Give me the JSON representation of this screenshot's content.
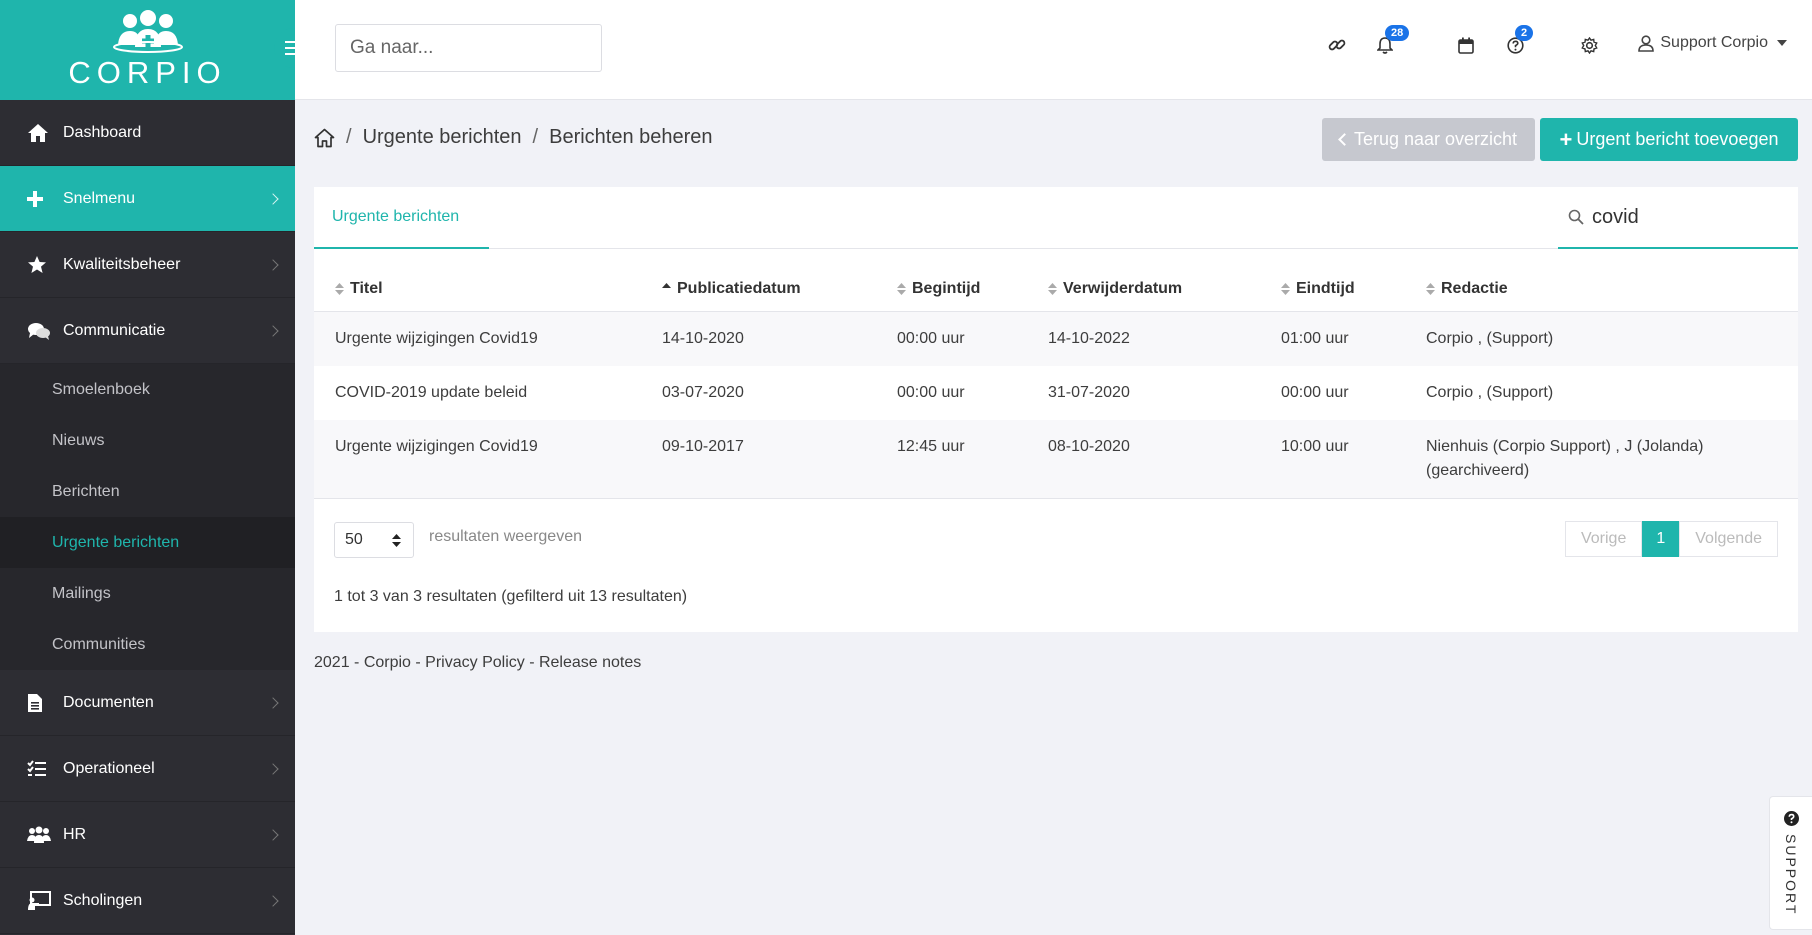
{
  "brand": {
    "name": "CORPIO",
    "accent": "#1fb5ac",
    "sidebar_bg": "#2d2d33"
  },
  "header": {
    "search_placeholder": "Ga naar...",
    "notifications_count": "28",
    "help_count": "2",
    "user_name": "Support Corpio"
  },
  "sidebar": {
    "items": [
      {
        "label": "Dashboard",
        "icon": "home-icon"
      },
      {
        "label": "Snelmenu",
        "icon": "plus-icon"
      },
      {
        "label": "Kwaliteitsbeheer",
        "icon": "star-icon"
      },
      {
        "label": "Communicatie",
        "icon": "chat-icon"
      }
    ],
    "sub_items": [
      "Smoelenboek",
      "Nieuws",
      "Berichten",
      "Urgente berichten",
      "Mailings",
      "Communities"
    ],
    "items_bottom": [
      {
        "label": "Documenten",
        "icon": "document-icon"
      },
      {
        "label": "Operationeel",
        "icon": "checklist-icon"
      },
      {
        "label": "HR",
        "icon": "users-icon"
      },
      {
        "label": "Scholingen",
        "icon": "presentation-icon"
      }
    ]
  },
  "breadcrumb": {
    "level1": "Urgente berichten",
    "level2": "Berichten beheren"
  },
  "actions": {
    "back_label": "Terug naar overzicht",
    "add_label": "Urgent bericht toevoegen"
  },
  "tab": {
    "label": "Urgente berichten"
  },
  "filter": {
    "value": "covid"
  },
  "table": {
    "headers": [
      "Titel",
      "Publicatiedatum",
      "Begintijd",
      "Verwijderdatum",
      "Eindtijd",
      "Redactie"
    ],
    "rows": [
      [
        "Urgente wijzigingen Covid19",
        "14-10-2020",
        "00:00 uur",
        "14-10-2022",
        "01:00 uur",
        "Corpio , (Support)"
      ],
      [
        "COVID-2019 update beleid",
        "03-07-2020",
        "00:00 uur",
        "31-07-2020",
        "00:00 uur",
        "Corpio , (Support)"
      ],
      [
        "Urgente wijzigingen Covid19",
        "09-10-2017",
        "12:45 uur",
        "08-10-2020",
        "10:00 uur",
        "Nienhuis (Corpio Support) , J (Jolanda) (gearchiveerd)"
      ]
    ]
  },
  "pagination": {
    "page_size": "50",
    "page_size_label": "resultaten weergeven",
    "prev": "Vorige",
    "current": "1",
    "next": "Volgende",
    "info": "1 tot 3 van 3 resultaten (gefilterd uit 13 resultaten)"
  },
  "footer": {
    "year": "2021",
    "company": "Corpio",
    "privacy": "Privacy Policy",
    "release": "Release notes"
  },
  "support_tab": {
    "label": "SUPPORT"
  }
}
